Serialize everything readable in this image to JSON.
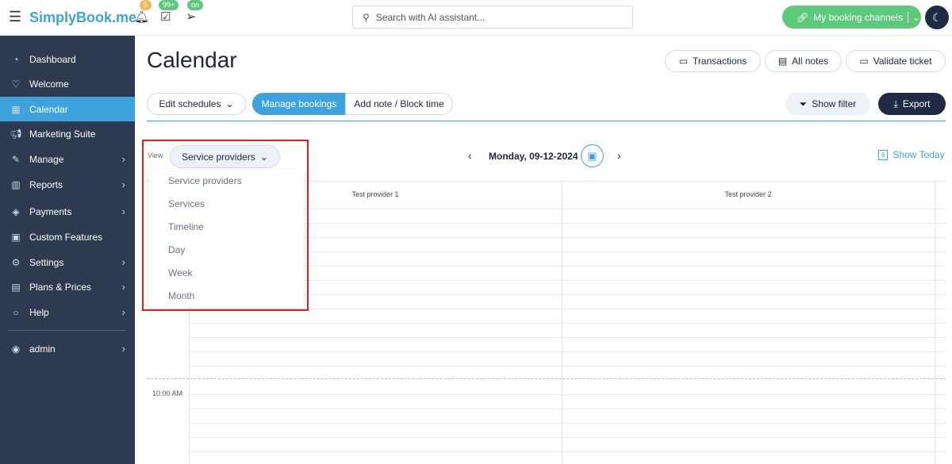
{
  "header": {
    "logo": "SimplyBook.me",
    "notifications_count": "5",
    "bookings_count": "99+",
    "channels_status": "on",
    "search_placeholder": "Search with AI assistant...",
    "booking_channels": "My booking channels"
  },
  "sidebar": {
    "items": [
      {
        "label": "Dashboard",
        "icon": "gauge-icon"
      },
      {
        "label": "Welcome",
        "icon": "bulb-icon"
      },
      {
        "label": "Calendar",
        "icon": "calendar-icon",
        "active": true
      },
      {
        "label": "Marketing Suite",
        "icon": "megaphone-icon"
      },
      {
        "label": "Manage",
        "icon": "pencil-icon",
        "chevron": true
      },
      {
        "label": "Reports",
        "icon": "chart-icon",
        "chevron": true
      },
      {
        "label": "Payments",
        "icon": "tag-icon",
        "chevron": true
      },
      {
        "label": "Custom Features",
        "icon": "gift-icon"
      },
      {
        "label": "Settings",
        "icon": "gear-icon",
        "chevron": true
      },
      {
        "label": "Plans & Prices",
        "icon": "cash-icon",
        "chevron": true
      },
      {
        "label": "Help",
        "icon": "chat-icon",
        "chevron": true
      }
    ],
    "user": "admin"
  },
  "page": {
    "title": "Calendar",
    "transactions": "Transactions",
    "all_notes": "All notes",
    "validate_ticket": "Validate ticket"
  },
  "toolbar": {
    "edit_schedules": "Edit schedules",
    "manage_bookings": "Manage bookings",
    "add_note": "Add note / Block time",
    "show_filter": "Show filter",
    "export": "Export"
  },
  "view": {
    "label": "View",
    "selected": "Service providers",
    "options": [
      "Service providers",
      "Services",
      "Timeline",
      "Day",
      "Week",
      "Month"
    ]
  },
  "date_nav": {
    "date": "Monday, 09-12-2024",
    "show_today": "Show Today",
    "today_day": "6"
  },
  "grid": {
    "columns": [
      "Test provider 1",
      "Test provider 2"
    ],
    "time_label": "10:00 AM"
  },
  "colors": {
    "accent": "#3ea3dc",
    "sidebar": "#2e3a4f",
    "green": "#5dc97a",
    "highlight": "#e02020"
  }
}
